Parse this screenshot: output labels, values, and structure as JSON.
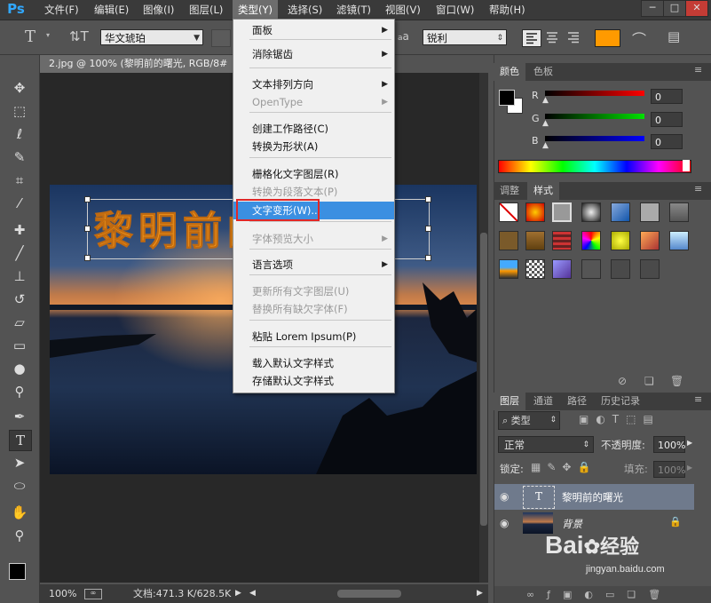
{
  "app": {
    "logo": "Ps"
  },
  "menubar": {
    "items": [
      "文件(F)",
      "编辑(E)",
      "图像(I)",
      "图层(L)",
      "类型(Y)",
      "选择(S)",
      "滤镜(T)",
      "视图(V)",
      "窗口(W)",
      "帮助(H)"
    ],
    "active_index": 4,
    "window_buttons": [
      "─",
      "□",
      "✕"
    ]
  },
  "options_bar": {
    "font_family": "华文琥珀",
    "antialias": "锐利",
    "text_color": "#ff9a00",
    "aa_label": "a"
  },
  "document": {
    "tab_title": "2.jpg @ 100% (黎明前的曙光, RGB/8#",
    "canvas_text": "黎明前的曙光",
    "canvas_text_color": "#f59a1e"
  },
  "status": {
    "zoom": "100%",
    "doc_info": "文档:471.3 K/628.5K"
  },
  "type_menu": {
    "items": [
      {
        "label": "面板",
        "submenu": true,
        "disabled": false
      },
      {
        "label": "消除锯齿",
        "submenu": true,
        "disabled": false
      },
      {
        "label": "文本排列方向",
        "submenu": true,
        "disabled": false
      },
      {
        "label": "OpenType",
        "submenu": true,
        "disabled": true
      },
      {
        "label": "创建工作路径(C)",
        "submenu": false,
        "disabled": false
      },
      {
        "label": "转换为形状(A)",
        "submenu": false,
        "disabled": false
      },
      {
        "label": "栅格化文字图层(R)",
        "submenu": false,
        "disabled": false
      },
      {
        "label": "转换为段落文本(P)",
        "submenu": false,
        "disabled": true
      },
      {
        "label": "文字变形(W)...",
        "submenu": false,
        "disabled": false,
        "highlighted": true
      },
      {
        "label": "字体预览大小",
        "submenu": true,
        "disabled": true
      },
      {
        "label": "语言选项",
        "submenu": true,
        "disabled": false
      },
      {
        "label": "更新所有文字图层(U)",
        "submenu": false,
        "disabled": true
      },
      {
        "label": "替换所有缺欠字体(F)",
        "submenu": false,
        "disabled": true
      },
      {
        "label": "粘贴 Lorem Ipsum(P)",
        "submenu": false,
        "disabled": false
      },
      {
        "label": "载入默认文字样式",
        "submenu": false,
        "disabled": false
      },
      {
        "label": "存储默认文字样式",
        "submenu": false,
        "disabled": false
      }
    ]
  },
  "color_panel": {
    "tabs": [
      "颜色",
      "色板"
    ],
    "channels": [
      {
        "label": "R",
        "value": "0"
      },
      {
        "label": "G",
        "value": "0"
      },
      {
        "label": "B",
        "value": "0"
      }
    ]
  },
  "styles_panel": {
    "tabs": [
      "调整",
      "样式"
    ],
    "active_tab": 1
  },
  "layers_panel": {
    "tabs": [
      "图层",
      "通道",
      "路径",
      "历史记录"
    ],
    "filter_label": "类型",
    "blend_mode": "正常",
    "opacity_label": "不透明度:",
    "opacity_value": "100%",
    "lock_label": "锁定:",
    "fill_label": "填充:",
    "fill_value": "100%",
    "layers": [
      {
        "name": "黎明前的曙光",
        "thumb": "T",
        "selected": true
      },
      {
        "name": "背景",
        "thumb": "",
        "selected": false
      }
    ]
  },
  "watermark": {
    "brand": "Bai",
    "brand_cn": "经验",
    "url": "jingyan.baidu.com"
  }
}
